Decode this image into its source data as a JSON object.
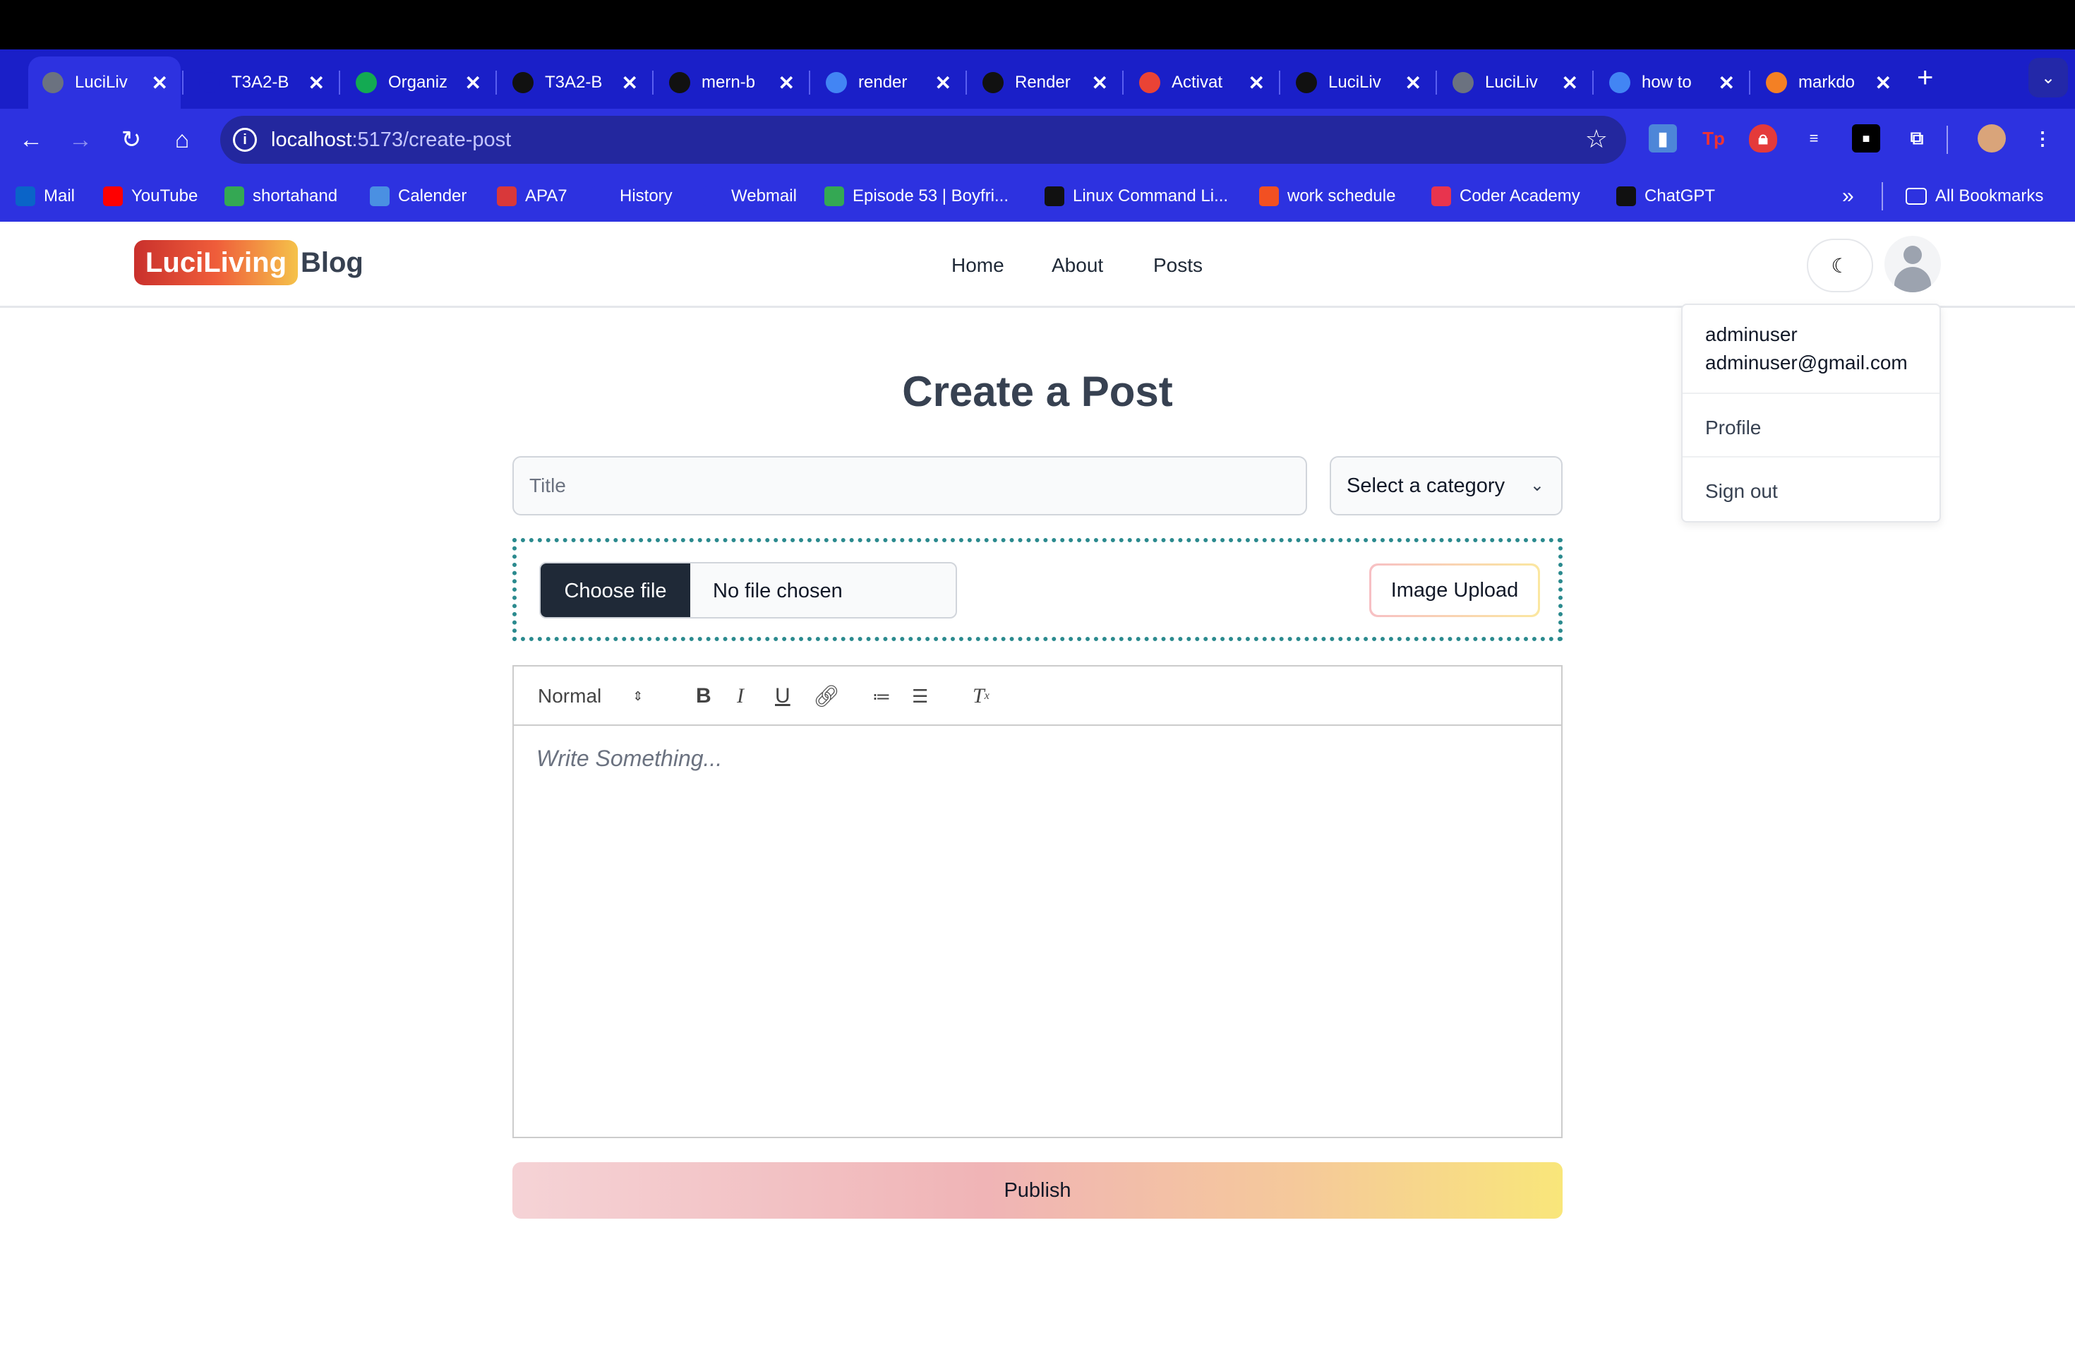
{
  "browser": {
    "tabs": [
      {
        "label": "LuciLiv",
        "icon": "globe-icon",
        "color": "#6b7280"
      },
      {
        "label": "T3A2-B",
        "icon": "ca-icon",
        "color": "#1a1fc8"
      },
      {
        "label": "Organiz",
        "icon": "mongodb-leaf-icon",
        "color": "#13aa52"
      },
      {
        "label": "T3A2-B",
        "icon": "github-icon",
        "color": "#111111"
      },
      {
        "label": "mern-b",
        "icon": "github-icon",
        "color": "#111111"
      },
      {
        "label": "render",
        "icon": "google-icon",
        "color": "#4285f4"
      },
      {
        "label": "Render",
        "icon": "render-icon",
        "color": "#111111"
      },
      {
        "label": "Activat",
        "icon": "gmail-icon",
        "color": "#ea4335"
      },
      {
        "label": "LuciLiv",
        "icon": "render-icon",
        "color": "#111111"
      },
      {
        "label": "LuciLiv",
        "icon": "globe-icon",
        "color": "#6b7280"
      },
      {
        "label": "how to",
        "icon": "google-icon",
        "color": "#4285f4"
      },
      {
        "label": "markdo",
        "icon": "stackoverflow-icon",
        "color": "#f48024"
      }
    ],
    "tab_close_glyph": "✕",
    "new_tab_glyph": "+",
    "url_host": "localhost",
    "url_path": ":5173/create-post",
    "bookmarks": [
      {
        "label": "Mail",
        "icon": "outlook-icon",
        "color": "#0a64c8"
      },
      {
        "label": "YouTube",
        "icon": "youtube-icon",
        "color": "#ff0000"
      },
      {
        "label": "shortahand",
        "icon": "drive-icon",
        "color": "#34a853"
      },
      {
        "label": "Calender",
        "icon": "calendar-icon",
        "color": "#4a90e2"
      },
      {
        "label": "APA7",
        "icon": "apa-icon",
        "color": "#d9383a"
      },
      {
        "label": "History",
        "icon": "history-icon",
        "color": "#2d32e0"
      },
      {
        "label": "Webmail",
        "icon": "webmail-icon",
        "color": "#2d32e0"
      },
      {
        "label": "Episode 53 | Boyfri...",
        "icon": "episode-icon",
        "color": "#34a853"
      },
      {
        "label": "Linux Command Li...",
        "icon": "linux-icon",
        "color": "#111111"
      },
      {
        "label": "work schedule",
        "icon": "microsoft-icon",
        "color": "#f25022"
      },
      {
        "label": "Coder Academy",
        "icon": "coder-academy-icon",
        "color": "#e8344e"
      },
      {
        "label": "ChatGPT",
        "icon": "chatgpt-icon",
        "color": "#111111"
      }
    ],
    "bookmarks_overflow": "»",
    "all_bookmarks": "All Bookmarks"
  },
  "site": {
    "logo_text": "LuciLiving",
    "logo_suffix": "Blog",
    "nav": [
      "Home",
      "About",
      "Posts"
    ],
    "theme_glyph": "☾",
    "user_menu": {
      "username": "adminuser",
      "email": "adminuser@gmail.com",
      "items": [
        "Profile",
        "Sign out"
      ]
    }
  },
  "form": {
    "heading": "Create a Post",
    "title_placeholder": "Title",
    "category_selected": "Select a category",
    "choose_file": "Choose file",
    "file_status": "No file chosen",
    "image_upload": "Image Upload",
    "editor": {
      "heading_select": "Normal",
      "placeholder": "Write Something..."
    },
    "publish": "Publish"
  },
  "colors": {
    "tab_bar": "#1a1fc8",
    "toolbar": "#2d32e0",
    "upload_border": "#2b8a8e"
  }
}
